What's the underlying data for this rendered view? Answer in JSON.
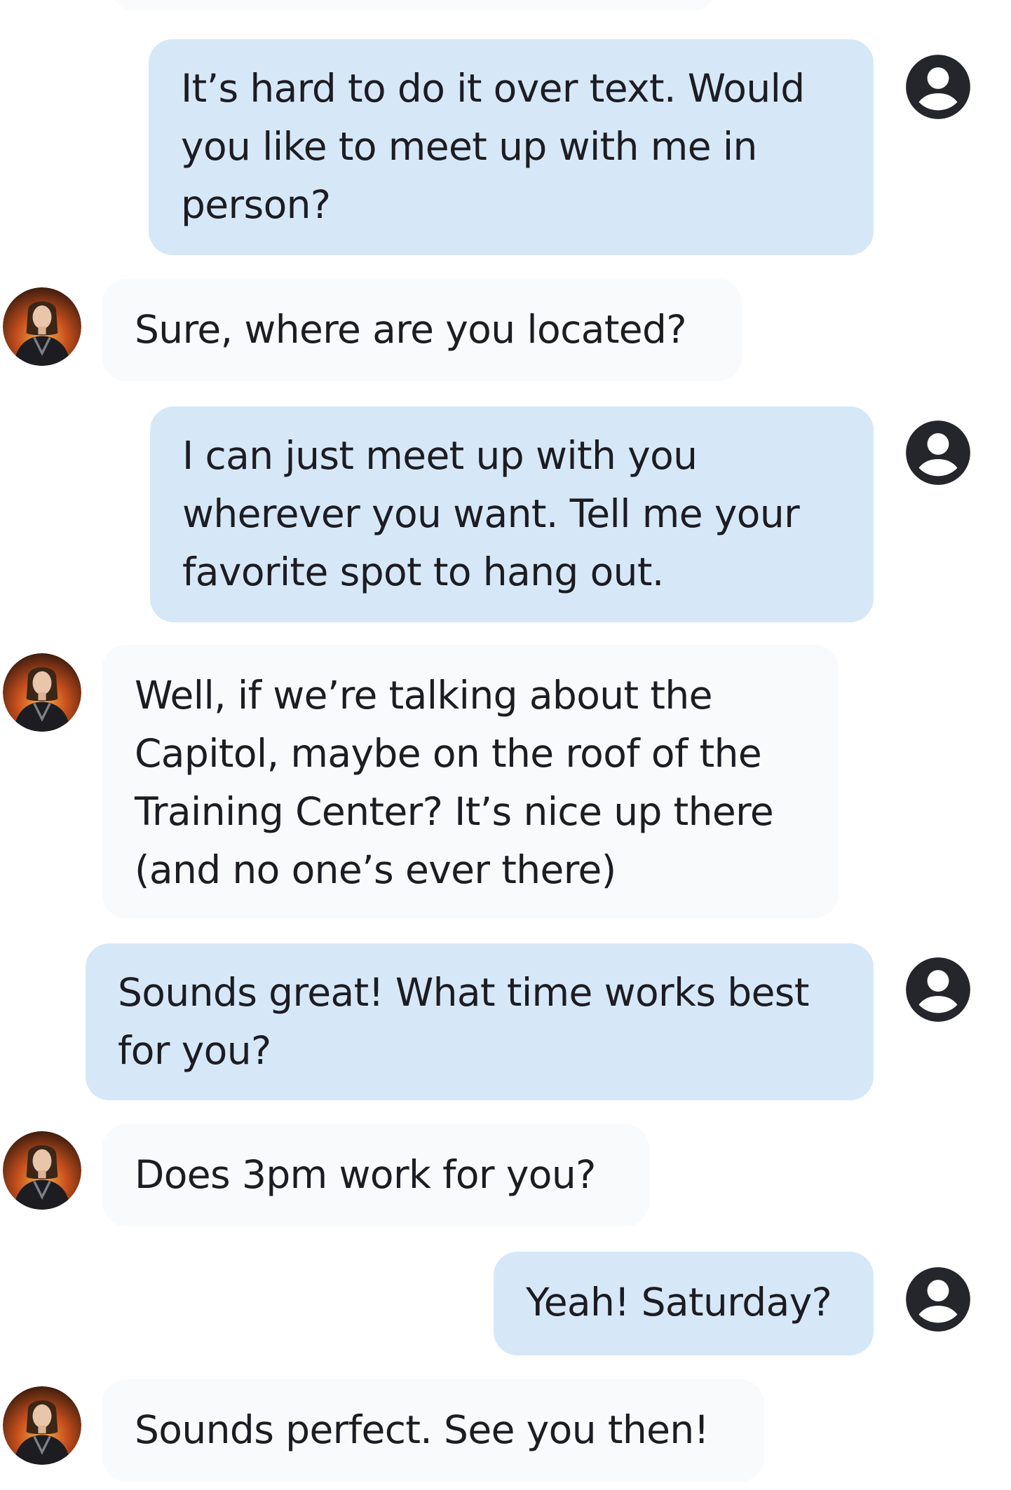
{
  "messages": [
    {
      "sender": "user",
      "text": "It’s hard to do it over text. Would you like to meet up with me in person?"
    },
    {
      "sender": "bot",
      "text": "Sure, where are you located?"
    },
    {
      "sender": "user",
      "text": "I can just meet up with you wherever you want. Tell me your favorite spot to hang out."
    },
    {
      "sender": "bot",
      "text": "Well, if we’re talking about the Capitol, maybe on the roof of the Training Center? It’s nice up there (and no one’s ever there)"
    },
    {
      "sender": "user",
      "text": "Sounds great! What time works best for you?"
    },
    {
      "sender": "bot",
      "text": "Does 3pm work for you?"
    },
    {
      "sender": "user",
      "text": "Yeah! Saturday?"
    },
    {
      "sender": "bot",
      "text": "Sounds perfect. See you then!"
    }
  ],
  "icons": {
    "user_avatar": "account-circle-icon",
    "bot_avatar": "character-portrait"
  },
  "colors": {
    "user_bubble": "#d6e8f7",
    "bot_bubble": "#f9fafc",
    "text": "#1c1c22",
    "user_icon": "#24262b"
  }
}
